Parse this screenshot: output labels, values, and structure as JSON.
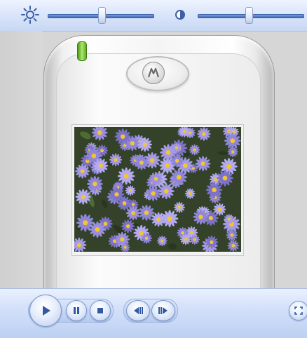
{
  "toolbar": {
    "brightness": {
      "icon": "brightness-sun-icon",
      "value": 0.42
    },
    "contrast": {
      "icon": "contrast-half-circle-icon",
      "value": 0.55
    }
  },
  "device": {
    "brand_logo": "motorola-logo-icon",
    "status_led_color": "#8ed34a",
    "screen_image": "purple-aster-flowers-photo"
  },
  "controls": {
    "play": "play-icon",
    "pause": "pause-icon",
    "stop": "stop-icon",
    "previous": "skip-back-icon",
    "next": "skip-forward-icon",
    "fullscreen": "fullscreen-icon"
  },
  "colors": {
    "accent": "#3f67b8",
    "bar": "#d3e0fa"
  }
}
